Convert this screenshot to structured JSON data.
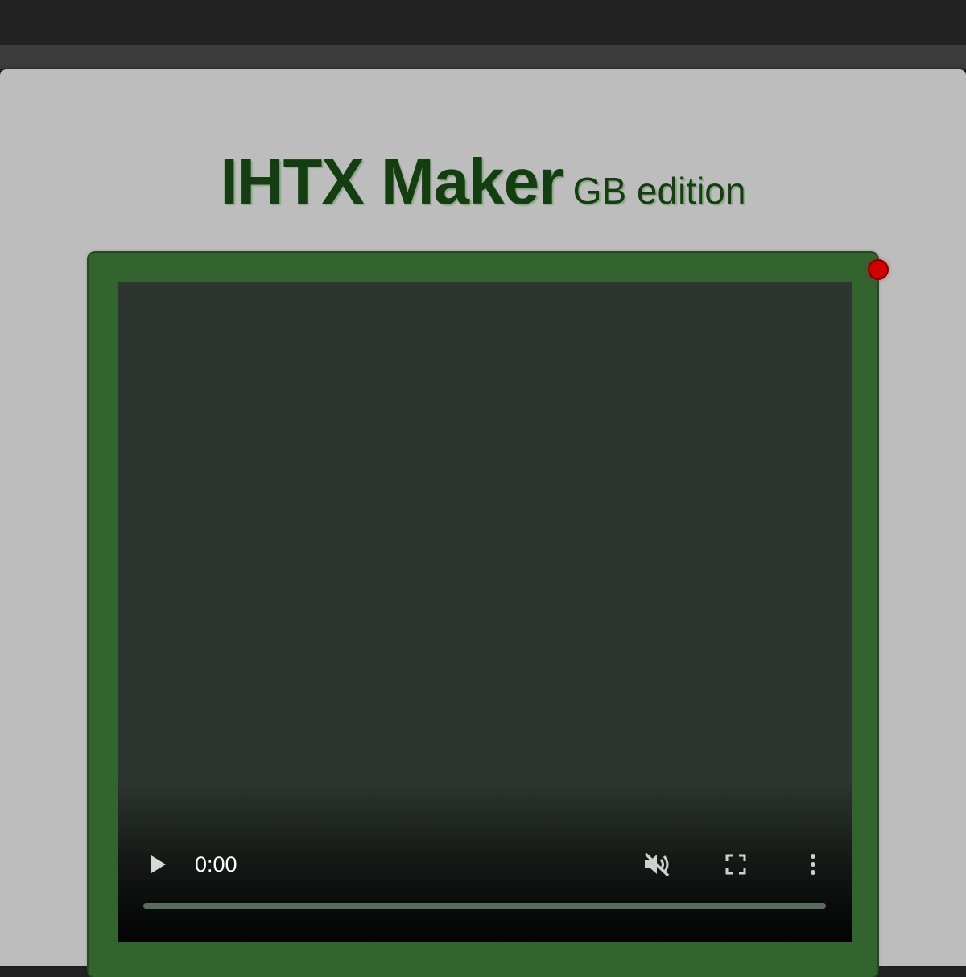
{
  "app": {
    "title": "IHTX Maker",
    "subtitle": "GB edition"
  },
  "player": {
    "current_time": "0:00",
    "progress_fraction": 0,
    "icons": {
      "play": "play-icon",
      "mute": "volume-muted-icon",
      "fullscreen": "fullscreen-icon",
      "more": "more-vertical-icon"
    }
  },
  "colors": {
    "frame": "#33632f",
    "title": "#143d12",
    "screen": "#2d3530",
    "led": "#d10000"
  }
}
